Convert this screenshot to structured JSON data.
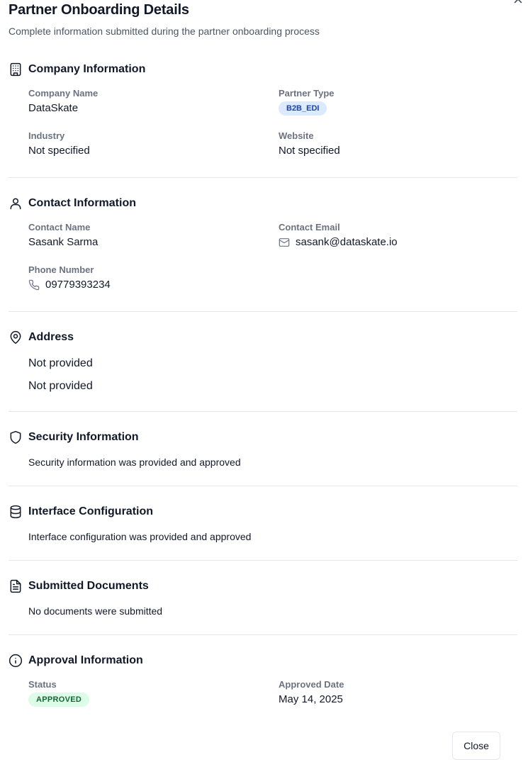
{
  "dialog": {
    "title": "Partner Onboarding Details",
    "subtitle": "Complete information submitted during the partner onboarding process",
    "close_button": "Close"
  },
  "company": {
    "title": "Company Information",
    "icon": "building-icon",
    "company_name_label": "Company Name",
    "company_name": "DataSkate",
    "partner_type_label": "Partner Type",
    "partner_type": "B2B_EDI",
    "industry_label": "Industry",
    "industry": "Not specified",
    "website_label": "Website",
    "website": "Not specified"
  },
  "contact": {
    "title": "Contact Information",
    "icon": "user-icon",
    "name_label": "Contact Name",
    "name": "Sasank Sarma",
    "email_label": "Contact Email",
    "email": "sasank@dataskate.io",
    "phone_label": "Phone Number",
    "phone": "09779393234"
  },
  "address": {
    "title": "Address",
    "icon": "map-pin-icon",
    "line1": "Not provided",
    "line2": "Not provided"
  },
  "security": {
    "title": "Security Information",
    "icon": "shield-icon",
    "text": "Security information was provided and approved"
  },
  "interface": {
    "title": "Interface Configuration",
    "icon": "database-icon",
    "text": "Interface configuration was provided and approved"
  },
  "documents": {
    "title": "Submitted Documents",
    "icon": "file-text-icon",
    "text": "No documents were submitted"
  },
  "approval": {
    "title": "Approval Information",
    "icon": "info-icon",
    "status_label": "Status",
    "status": "APPROVED",
    "date_label": "Approved Date",
    "date": "May 14, 2025"
  },
  "colors": {
    "badge_blue_bg": "#dbeafe",
    "badge_blue_text": "#1e40af",
    "badge_green_bg": "#dcfce7",
    "badge_green_text": "#166534",
    "muted_label": "#6b7280",
    "divider": "#e5e7eb"
  }
}
